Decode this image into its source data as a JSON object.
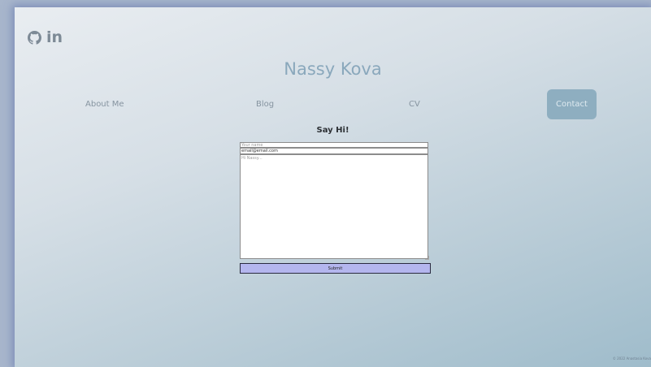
{
  "social": {
    "github_icon": "github-icon",
    "linkedin_label": "in"
  },
  "header": {
    "title": "Nassy Kova"
  },
  "nav": {
    "items": [
      {
        "label": "About Me"
      },
      {
        "label": "Blog"
      },
      {
        "label": "CV"
      },
      {
        "label": "Contact",
        "active": true
      }
    ],
    "active_color": "#8eaec0"
  },
  "form": {
    "title": "Say Hi!",
    "name_placeholder": "Your name",
    "email_value": "email@email.com",
    "message_placeholder": "Hi Nassy...",
    "submit_label": "Submit"
  },
  "footer": {
    "text": "© 2022 Anastasia Kova"
  }
}
